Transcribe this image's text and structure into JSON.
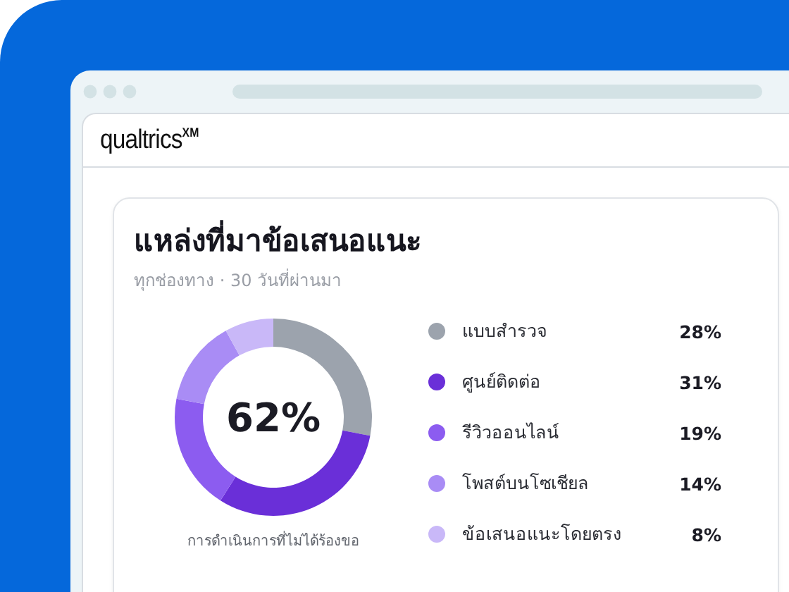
{
  "browser": {
    "logo": "qualtrics$^{XM}$"
  },
  "card": {
    "title": "แหล่งที่มาข้อเสนอแนะ",
    "subtitle": "ทุกช่องทาง · 30 วันที่ผ่านมา",
    "center_value": "62%",
    "caption": "การดำเนินการที่ไม่ได้ร้องขอ",
    "legend": [
      {
        "value": "28%",
        "color": "#9ca3ad"
      },
      {
        "value": "31%",
        "color": "#6a2fd8"
      },
      {
        "value": "19%",
        "color": "#8c5cf0"
      },
      {
        "value": "14%",
        "color": "#a98cf5"
      },
      {
        "value": "8%",
        "color": "#c9b8f8"
      }
    ],
    "chart_data": {
      "type": "donut",
      "categories": [
        "แบบสำรวจ",
        "ศูนย์ติดต่อ",
        "รีวิวออนไลน์",
        "โพสต์บนโซเชียล",
        "ข้อเสนอแนะโดยตรง"
      ],
      "values": [
        28,
        31,
        19,
        14,
        8
      ]
    }
  }
}
